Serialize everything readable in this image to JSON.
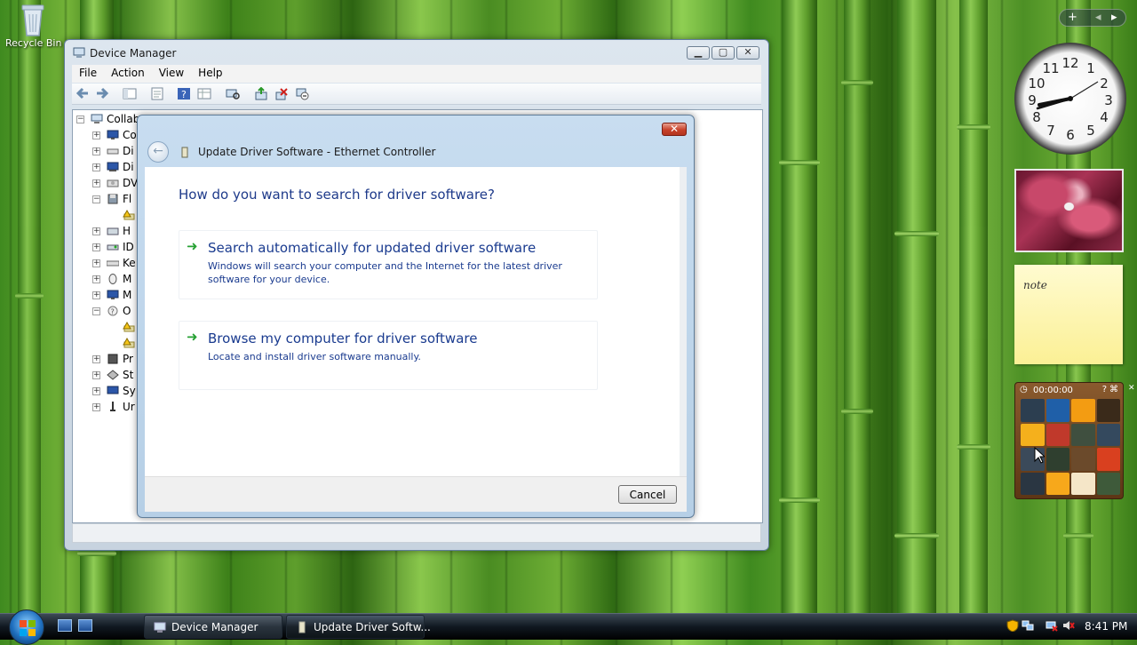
{
  "desktop": {
    "recycle_bin_label": "Recycle Bin"
  },
  "device_manager": {
    "title": "Device Manager",
    "menu": [
      "File",
      "Action",
      "View",
      "Help"
    ],
    "tree": [
      {
        "label": "Collab",
        "expander": "−",
        "icon": "computer-icon"
      },
      {
        "label": "Co",
        "expander": "+",
        "icon": "monitor-icon"
      },
      {
        "label": "Di",
        "expander": "+",
        "icon": "disk-drive-icon"
      },
      {
        "label": "Di",
        "expander": "+",
        "icon": "display-adapter-icon"
      },
      {
        "label": "DV",
        "expander": "+",
        "icon": "dvd-drive-icon"
      },
      {
        "label": "Fl",
        "expander": "−",
        "icon": "floppy-icon"
      },
      {
        "label": "",
        "expander": "",
        "icon": "warning-device-icon"
      },
      {
        "label": "H",
        "expander": "+",
        "icon": "hid-icon"
      },
      {
        "label": "ID",
        "expander": "+",
        "icon": "ide-controller-icon"
      },
      {
        "label": "Ke",
        "expander": "+",
        "icon": "keyboard-icon"
      },
      {
        "label": "M",
        "expander": "+",
        "icon": "mouse-icon"
      },
      {
        "label": "M",
        "expander": "+",
        "icon": "monitor-icon"
      },
      {
        "label": "O",
        "expander": "−",
        "icon": "other-devices-icon"
      },
      {
        "label": "",
        "expander": "",
        "icon": "warning-device-icon"
      },
      {
        "label": "",
        "expander": "",
        "icon": "warning-device-icon"
      },
      {
        "label": "Pr",
        "expander": "+",
        "icon": "processor-icon"
      },
      {
        "label": "St",
        "expander": "+",
        "icon": "storage-icon"
      },
      {
        "label": "Sy",
        "expander": "+",
        "icon": "system-devices-icon"
      },
      {
        "label": "Ur",
        "expander": "+",
        "icon": "usb-icon"
      }
    ]
  },
  "update_driver": {
    "header_title": "Update Driver Software - Ethernet Controller",
    "heading": "How do you want to search for driver software?",
    "options": [
      {
        "title": "Search automatically for updated driver software",
        "description": "Windows will search your computer and the Internet for the latest driver software for your device."
      },
      {
        "title": "Browse my computer for driver software",
        "description": "Locate and install driver software manually."
      }
    ],
    "cancel_label": "Cancel",
    "close_glyph": "✕",
    "back_glyph": "←",
    "arrow_glyph": "➜"
  },
  "gadgets": {
    "note_text": "note",
    "puzzle_timer": "00:00:00",
    "clock_numbers": [
      "12",
      "1",
      "2",
      "3",
      "4",
      "5",
      "6",
      "7",
      "8",
      "9",
      "10",
      "11"
    ],
    "add_glyph": "+",
    "prev_glyph": "◂",
    "next_glyph": "▸",
    "tile_colors": [
      "#2c3e50",
      "#1f5fa8",
      "#f39c12",
      "#3a2a1a",
      "#f5b01c",
      "#c0392b",
      "#3f4f3f",
      "#34495e",
      "#3b4a5a",
      "#2f3f2f",
      "#6b4a2b",
      "#d9401f",
      "#2a3642",
      "#f7a81b",
      "#f5e6c8",
      "#3e5a3a"
    ]
  },
  "taskbar": {
    "buttons": [
      {
        "label": "Device Manager",
        "active": false
      },
      {
        "label": "Update Driver Softw...",
        "active": true
      }
    ],
    "time": "8:41 PM"
  },
  "colors": {
    "link_blue": "#1a3b8f",
    "arrow_green": "#27a134",
    "close_red": "#c8412a"
  }
}
